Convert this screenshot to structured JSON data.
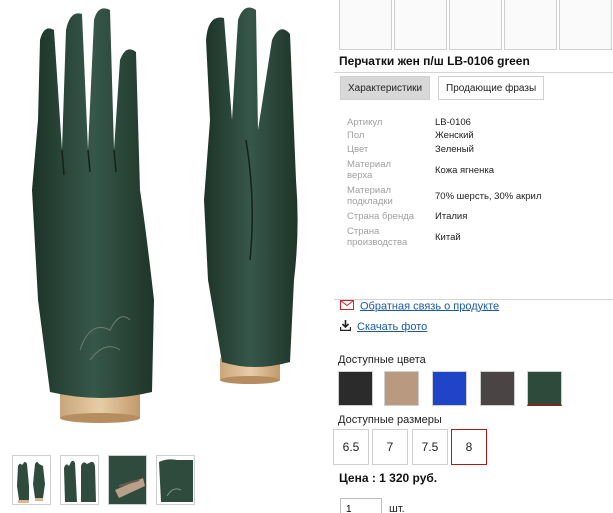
{
  "product": {
    "title": "Перчатки жен п/ш LB-0106 green"
  },
  "tabs": [
    {
      "label": "Характеристики",
      "active": true
    },
    {
      "label": "Продающие фразы",
      "active": false
    }
  ],
  "specs": [
    {
      "label": "Артикул",
      "value": "LB-0106"
    },
    {
      "label": "Пол",
      "value": "Женский"
    },
    {
      "label": "Цвет",
      "value": "Зеленый"
    },
    {
      "label": "Материал верха",
      "value": "Кожа ягненка"
    },
    {
      "label": "Материал подкладки",
      "value": "70% шерсть, 30% акрил"
    },
    {
      "label": "Страна бренда",
      "value": "Италия"
    },
    {
      "label": "Страна производства",
      "value": "Китай"
    }
  ],
  "links": {
    "feedback": "Обратная связь о продукте",
    "download_photo": "Скачать фото"
  },
  "colors": {
    "title": "Доступные цвета",
    "swatches": [
      "#2b2b2b",
      "#b99a80",
      "#1f44c8",
      "#4a4444",
      "#2e4a3b"
    ],
    "selected_index": 4
  },
  "sizes": {
    "title": "Доступные размеры",
    "options": [
      "6.5",
      "7",
      "7.5",
      "8"
    ],
    "selected": "8"
  },
  "price": {
    "text": "Цена : 1 320 руб."
  },
  "quantity": {
    "value": "1",
    "unit": "шт."
  },
  "theme": {
    "glove_green": "#2f4b3d",
    "link_blue": "#1a5aa8",
    "selected_red": "#b01818"
  }
}
